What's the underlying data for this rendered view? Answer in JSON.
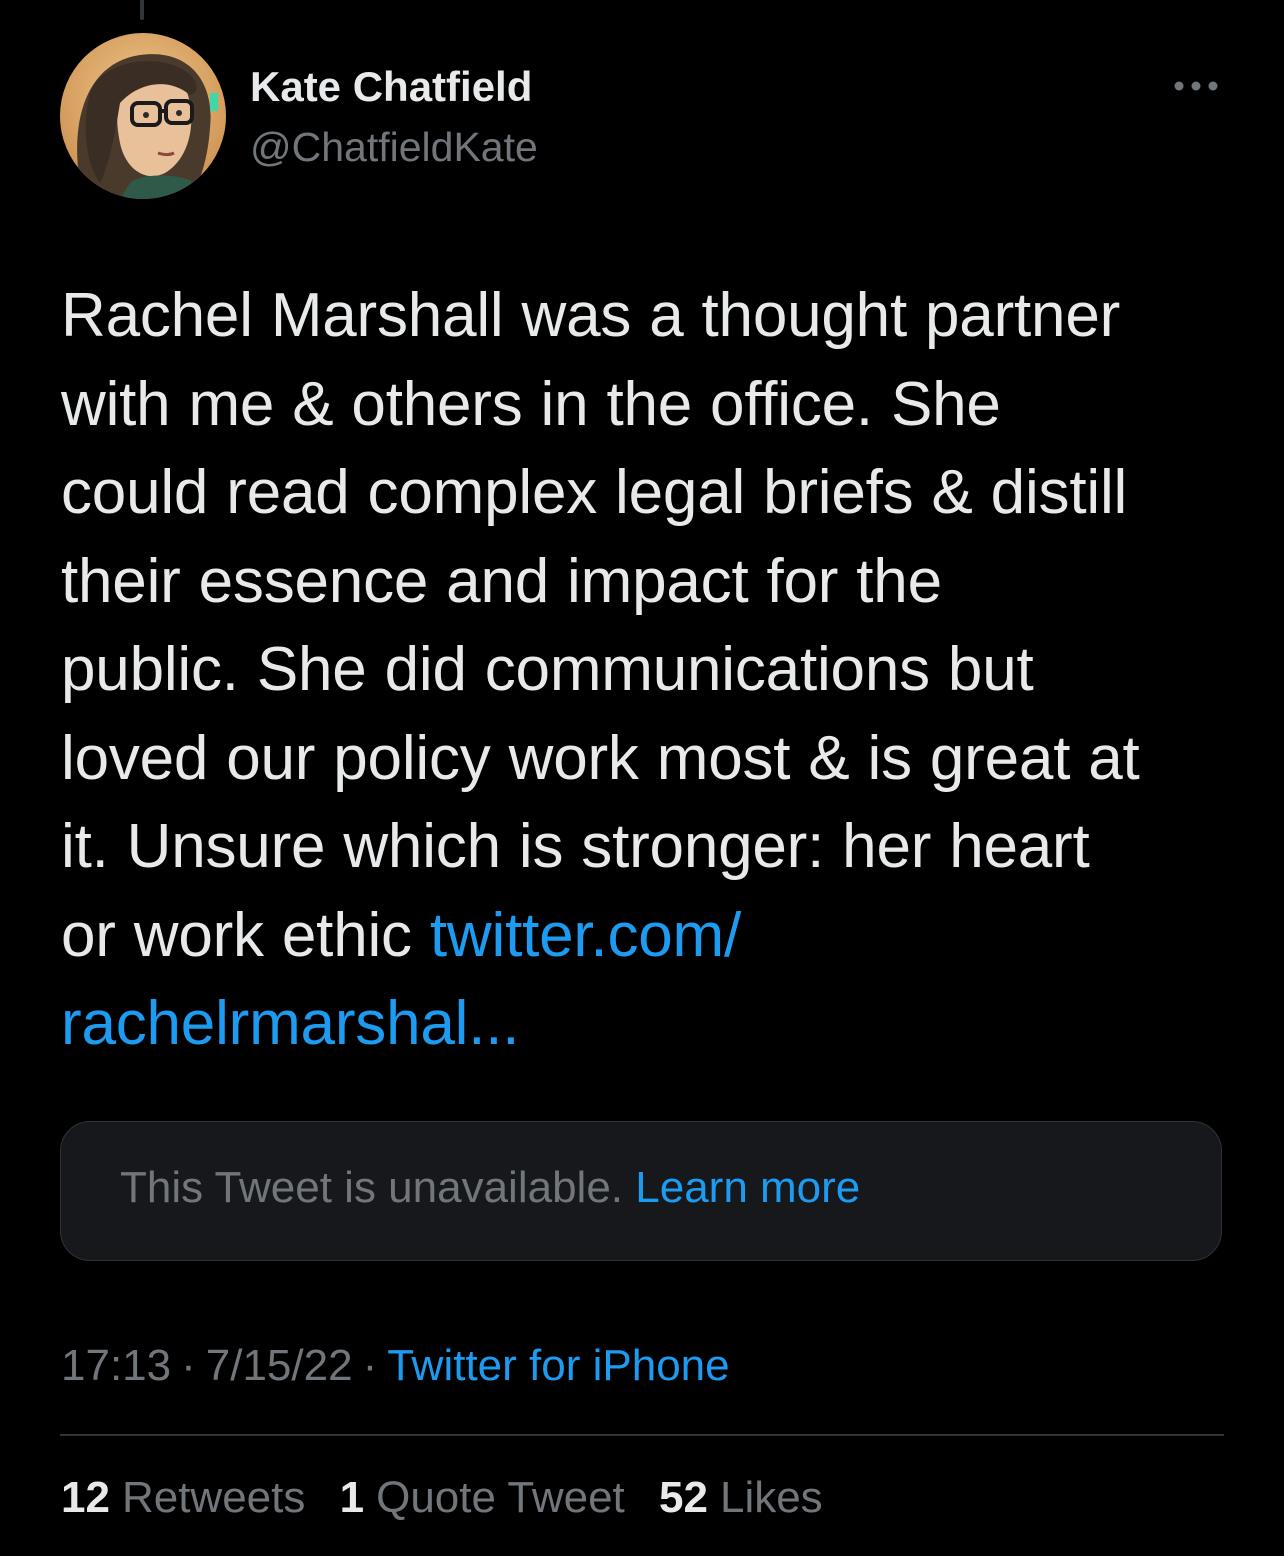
{
  "author": {
    "name": "Kate Chatfield",
    "handle": "@ChatfieldKate"
  },
  "tweet": {
    "lines": [
      "Rachel Marshall was a thought partner",
      "with me & others in the office. She",
      "could read complex legal briefs & distill",
      "their essence and impact for the",
      "public. She did communications but",
      "loved our policy work most & is great at",
      "it. Unsure which is stronger: her heart"
    ],
    "last_line_text": "or work ethic",
    "link_part1": "twitter.com/",
    "link_part2": "rachelrmarshal..."
  },
  "quoted": {
    "message": "This Tweet is unavailable.",
    "learn_more": "Learn more"
  },
  "meta": {
    "time": "17:13",
    "date": "7/15/22",
    "separator": "·",
    "source": "Twitter for iPhone"
  },
  "stats": {
    "retweets_count": "12",
    "retweets_label": "Retweets",
    "quotes_count": "1",
    "quotes_label": "Quote Tweet",
    "likes_count": "52",
    "likes_label": "Likes"
  },
  "colors": {
    "background": "#000000",
    "text": "#e7e9ea",
    "secondary": "#71767b",
    "link": "#1d9bf0",
    "card": "#16181c",
    "border": "#2f3336"
  },
  "icons": {
    "more": "more-horizontal-icon",
    "avatar": "profile-avatar"
  }
}
